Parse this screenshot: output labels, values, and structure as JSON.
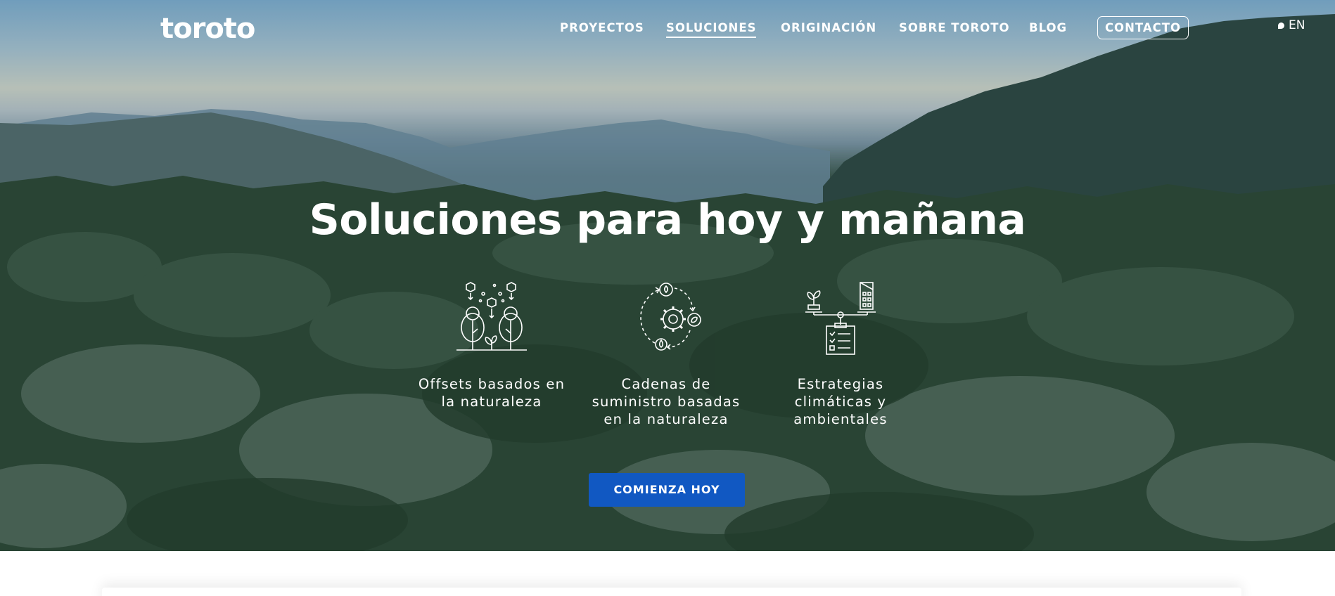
{
  "brand": {
    "logo_text": "toroto"
  },
  "nav": {
    "items": [
      {
        "label": "PROYECTOS",
        "active": false
      },
      {
        "label": "SOLUCIONES",
        "active": true
      },
      {
        "label": "ORIGINACIÓN",
        "active": false
      },
      {
        "label": "SOBRE TOROTO",
        "active": false
      },
      {
        "label": "BLOG",
        "active": false
      }
    ],
    "contact_label": "CONTACTO",
    "language_label": "EN"
  },
  "hero": {
    "title": "Soluciones para hoy y mañana",
    "solutions": [
      {
        "label": "Offsets basados en la naturaleza",
        "icon": "forest-co2-icon"
      },
      {
        "label": "Cadenas de suministro basadas en la naturaleza",
        "icon": "supply-chain-cycle-icon"
      },
      {
        "label": "Estrategias climáticas y ambientales",
        "icon": "strategy-balance-icon"
      }
    ],
    "cta_label": "COMIENZA HOY"
  },
  "colors": {
    "cta_background": "#1158c2",
    "text": "#ffffff"
  }
}
